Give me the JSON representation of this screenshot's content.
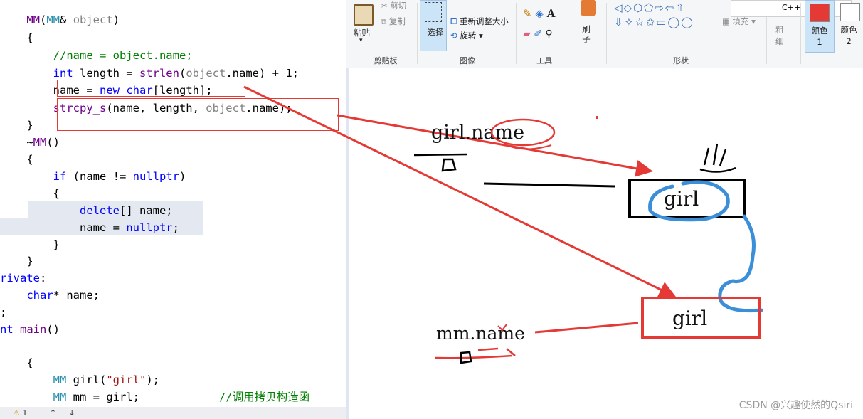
{
  "editor": {
    "lines": [
      {
        "parts": [
          {
            "t": "    "
          },
          {
            "t": "MM",
            "c": "pp"
          },
          {
            "t": "("
          },
          {
            "t": "MM",
            "c": "ty"
          },
          {
            "t": "& "
          },
          {
            "t": "object",
            "c": "pm"
          },
          {
            "t": ")"
          }
        ]
      },
      {
        "parts": [
          {
            "t": "    {"
          }
        ]
      },
      {
        "parts": [
          {
            "t": "        "
          },
          {
            "t": "//name = object.name;",
            "c": "cm"
          }
        ]
      },
      {
        "parts": [
          {
            "t": "        "
          },
          {
            "t": "int",
            "c": "kw"
          },
          {
            "t": " length = "
          },
          {
            "t": "strlen",
            "c": "pp"
          },
          {
            "t": "("
          },
          {
            "t": "object",
            "c": "pm"
          },
          {
            "t": ".name) + 1;"
          }
        ]
      },
      {
        "parts": [
          {
            "t": "        name = "
          },
          {
            "t": "new",
            "c": "kw"
          },
          {
            "t": " "
          },
          {
            "t": "char",
            "c": "kw"
          },
          {
            "t": "[length];"
          }
        ]
      },
      {
        "parts": [
          {
            "t": "        "
          },
          {
            "t": "strcpy_s",
            "c": "pp"
          },
          {
            "t": "(name, length, "
          },
          {
            "t": "object",
            "c": "pm"
          },
          {
            "t": ".name);"
          }
        ]
      },
      {
        "parts": [
          {
            "t": "    }"
          }
        ]
      },
      {
        "parts": [
          {
            "t": "    ~"
          },
          {
            "t": "MM",
            "c": "pp"
          },
          {
            "t": "()"
          }
        ]
      },
      {
        "parts": [
          {
            "t": "    {"
          }
        ]
      },
      {
        "parts": [
          {
            "t": "        "
          },
          {
            "t": "if",
            "c": "kw"
          },
          {
            "t": " (name != "
          },
          {
            "t": "nullptr",
            "c": "kw"
          },
          {
            "t": ")"
          }
        ]
      },
      {
        "parts": [
          {
            "t": "        {"
          }
        ]
      },
      {
        "parts": [
          {
            "t": "            "
          },
          {
            "t": "delete",
            "c": "kw"
          },
          {
            "t": "[] name;"
          }
        ]
      },
      {
        "parts": [
          {
            "t": "            name = "
          },
          {
            "t": "nullptr",
            "c": "kw"
          },
          {
            "t": ";"
          }
        ]
      },
      {
        "parts": [
          {
            "t": "        }"
          }
        ]
      },
      {
        "parts": [
          {
            "t": "    }"
          }
        ]
      },
      {
        "parts": [
          {
            "t": "rivate",
            "c": "kw"
          },
          {
            "t": ":"
          }
        ]
      },
      {
        "parts": [
          {
            "t": "    "
          },
          {
            "t": "char",
            "c": "kw"
          },
          {
            "t": "* name;"
          }
        ]
      },
      {
        "parts": [
          {
            "t": ";"
          }
        ]
      },
      {
        "parts": [
          {
            "t": "nt",
            "c": "kw"
          },
          {
            "t": " "
          },
          {
            "t": "main",
            "c": "pp"
          },
          {
            "t": "()"
          }
        ]
      },
      {
        "parts": [
          {
            "t": ""
          }
        ]
      },
      {
        "parts": [
          {
            "t": "    {"
          }
        ]
      },
      {
        "parts": [
          {
            "t": "        "
          },
          {
            "t": "MM",
            "c": "ty"
          },
          {
            "t": " girl("
          },
          {
            "t": "\"girl\"",
            "c": "st"
          },
          {
            "t": ");"
          }
        ]
      },
      {
        "parts": [
          {
            "t": "        "
          },
          {
            "t": "MM",
            "c": "ty"
          },
          {
            "t": " mm = girl;"
          },
          {
            "t": "            "
          },
          {
            "t": "//调用拷贝构造函",
            "c": "cm"
          }
        ]
      }
    ],
    "status": {
      "warning_count": "1"
    }
  },
  "paint": {
    "ribbon": {
      "clipboard": {
        "paste": "粘贴",
        "cut": "剪切",
        "copy": "复制",
        "group": "剪贴板"
      },
      "image": {
        "select": "选择",
        "resize": "重新调整大小",
        "rotate": "旋转",
        "group": "图像"
      },
      "tools": {
        "group": "工具"
      },
      "brushes": {
        "label": "刷子"
      },
      "shapes": {
        "fill": "填充",
        "group": "形状"
      },
      "size": {
        "label": "粗细"
      },
      "color1": {
        "label": "颜色 1"
      },
      "color2": {
        "label": "颜色 2"
      },
      "tooltip": "C++"
    },
    "canvas": {
      "girl_name_label": "girl.name",
      "girl_box_text": "girl",
      "mm_name_label": "mm.name",
      "mm_box_text": "girl"
    },
    "watermark": "CSDN @兴趣使然的Qsiri"
  }
}
